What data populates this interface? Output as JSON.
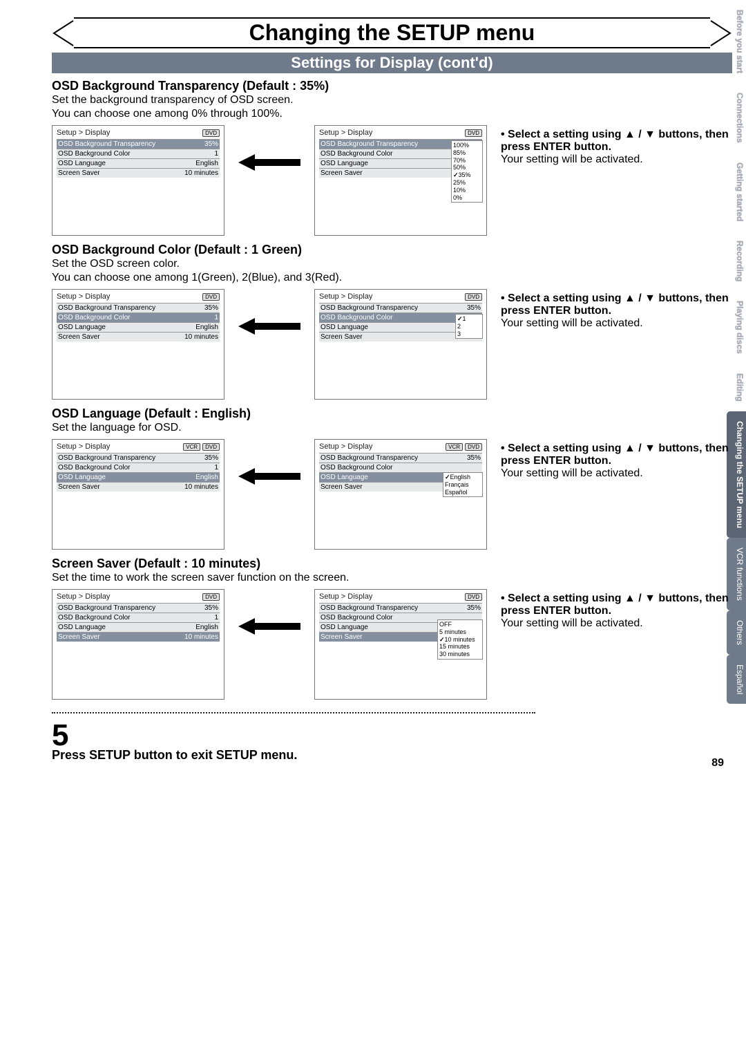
{
  "page_number": "89",
  "page_title": "Changing the SETUP menu",
  "section_title": "Settings for Display (cont'd)",
  "tabs": [
    "Before you start",
    "Connections",
    "Getting started",
    "Recording",
    "Playing discs",
    "Editing",
    "Changing the SETUP menu",
    "VCR functions",
    "Others",
    "Español"
  ],
  "tabs_active_index": 6,
  "common": {
    "instruction_bullet": "• Select a setting using ▲ / ▼ buttons, then press ENTER button.",
    "instruction_sub": "Your setting will be activated.",
    "breadcrumb": "Setup > Display",
    "badge_dvd": "DVD",
    "badge_vcr": "VCR",
    "row_transparency": "OSD Background Transparency",
    "row_color": "OSD Background Color",
    "row_language": "OSD Language",
    "row_saver": "Screen Saver",
    "val_transparency": "35%",
    "val_color": "1",
    "val_language": "English",
    "val_saver": "10 minutes"
  },
  "settings": {
    "transparency": {
      "heading": "OSD Background Transparency (Default : 35%)",
      "desc1": "Set the background transparency of OSD screen.",
      "desc2": "You can choose one among 0% through 100%.",
      "options": [
        "100%",
        "85%",
        "70%",
        "50%",
        "35%",
        "25%",
        "10%",
        "0%"
      ],
      "selected": "35%"
    },
    "color": {
      "heading": "OSD Background Color (Default : 1 Green)",
      "desc1": "Set the OSD screen color.",
      "desc2": "You can choose one among 1(Green), 2(Blue), and 3(Red).",
      "options": [
        "1",
        "2",
        "3"
      ],
      "selected": "1"
    },
    "language": {
      "heading": "OSD Language (Default : English)",
      "desc1": "Set the language for OSD.",
      "options": [
        "English",
        "Français",
        "Español"
      ],
      "selected": "English"
    },
    "saver": {
      "heading": "Screen Saver (Default : 10 minutes)",
      "desc1": "Set the time to work the screen saver function on the screen.",
      "options": [
        "OFF",
        "5 minutes",
        "10 minutes",
        "15 minutes",
        "30 minutes"
      ],
      "selected": "10 minutes"
    }
  },
  "step5": {
    "num": "5",
    "text": "Press SETUP button to exit SETUP menu."
  }
}
